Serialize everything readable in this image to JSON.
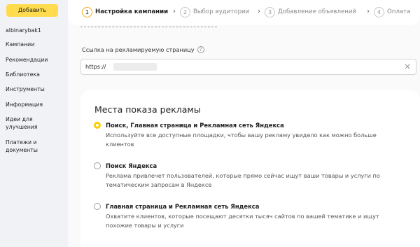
{
  "sidebar": {
    "add_button": "Добавить",
    "items": [
      {
        "label": "albinarybak1"
      },
      {
        "label": "Кампании"
      },
      {
        "label": "Рекомендации"
      },
      {
        "label": "Библиотека"
      },
      {
        "label": "Инструменты"
      },
      {
        "label": "Информация"
      },
      {
        "label": "Идеи для улучшения"
      },
      {
        "label": "Платежи и документы"
      }
    ]
  },
  "steps": [
    {
      "num": "1",
      "label": "Настройка кампании",
      "active": true
    },
    {
      "num": "2",
      "label": "Выбор аудитории"
    },
    {
      "num": "3",
      "label": "Добавление объявлений"
    },
    {
      "num": "4",
      "label": "Оплата"
    }
  ],
  "step_separator": "›",
  "url_field": {
    "label": "Ссылка на рекламируемую страницу",
    "help_icon": "question-circle-icon",
    "value": "https://",
    "clear_icon": "close-icon"
  },
  "placements": {
    "title": "Места показа рекламы",
    "options": [
      {
        "title": "Поиск, Главная страница и Рекламная сеть Яндекса",
        "desc": "Используйте все доступные площадки, чтобы вашу рекламу увидело как можно больше клиентов",
        "checked": true
      },
      {
        "title": "Поиск Яндекса",
        "desc": "Реклама привлечет пользователей, которые прямо сейчас ищут ваши товары и услуги по тематическим запросам в Яндексе",
        "checked": false
      },
      {
        "title": "Главная страница и Рекламная сеть Яндекса",
        "desc": "Охватите клиентов, которые посещают десятки тысяч сайтов по вашей тематике и ищут похожие товары и услуги",
        "checked": false
      }
    ]
  },
  "colors": {
    "accent": "#ffdb4d",
    "radio_checked": "#ffcc00",
    "step_active_ring": "#f7a91b"
  }
}
